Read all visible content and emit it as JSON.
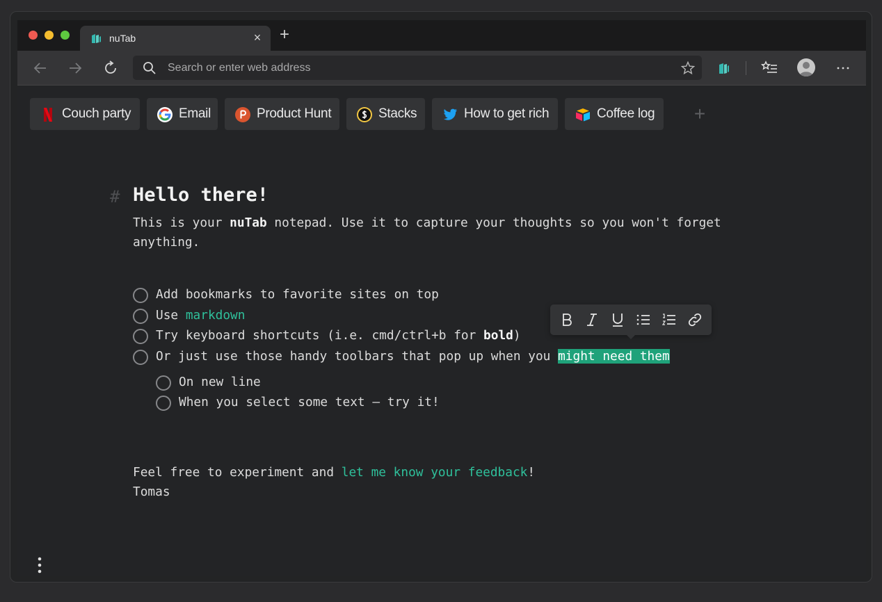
{
  "browser": {
    "tab_title": "nuTab",
    "tab_close": "×",
    "new_tab": "+",
    "address_placeholder": "Search or enter web address"
  },
  "bookmarks": [
    {
      "label": "Couch party",
      "icon": "netflix-icon"
    },
    {
      "label": "Email",
      "icon": "google-icon"
    },
    {
      "label": "Product Hunt",
      "icon": "product-hunt-icon"
    },
    {
      "label": "Stacks",
      "icon": "stacks-icon"
    },
    {
      "label": "How to get rich",
      "icon": "twitter-icon"
    },
    {
      "label": "Coffee log",
      "icon": "airtable-icon"
    }
  ],
  "bookmark_add": "+",
  "editor": {
    "heading_marker": "#",
    "heading": "Hello there!",
    "intro_before": "This is your ",
    "intro_bold": "nuTab",
    "intro_after": " notepad. Use it to capture your thoughts so you won't forget anything.",
    "todos": [
      {
        "before": "Add bookmarks to favorite sites on top"
      },
      {
        "before": "Use ",
        "link": "markdown"
      },
      {
        "before": "Try keyboard shortcuts (i.e. cmd/ctrl+b for ",
        "bold": "bold",
        "after": ")"
      },
      {
        "before": "Or just use those handy toolbars that pop up when you ",
        "highlight": "might need them"
      }
    ],
    "subtodos": [
      {
        "text": "On new line"
      },
      {
        "text": "When you select some text – try it!"
      }
    ],
    "footer_before": "Feel free to experiment and ",
    "footer_link": "let me know your feedback",
    "footer_after": "!",
    "signature": "Tomas"
  },
  "colors": {
    "accent": "#2fc09b",
    "highlight": "#1fa27a",
    "background": "#232426"
  }
}
